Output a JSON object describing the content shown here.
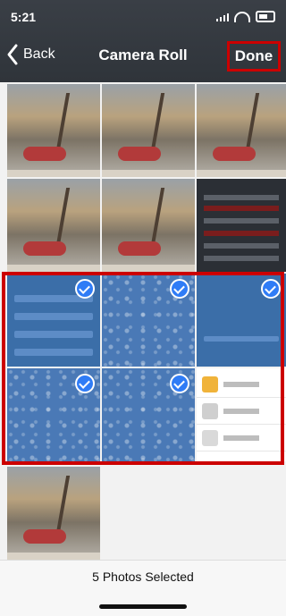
{
  "status_bar": {
    "time": "5:21"
  },
  "nav": {
    "back_label": "Back",
    "title": "Camera Roll",
    "done_label": "Done"
  },
  "footer": {
    "status": "5 Photos Selected"
  },
  "colors": {
    "accent": "#2f7cf6",
    "highlight": "#cc0000"
  },
  "icons": {
    "back": "chevron-left-icon",
    "selected": "checkmark-circle-icon",
    "signal": "signal-bars-icon",
    "wifi": "wifi-icon",
    "battery": "battery-icon"
  }
}
